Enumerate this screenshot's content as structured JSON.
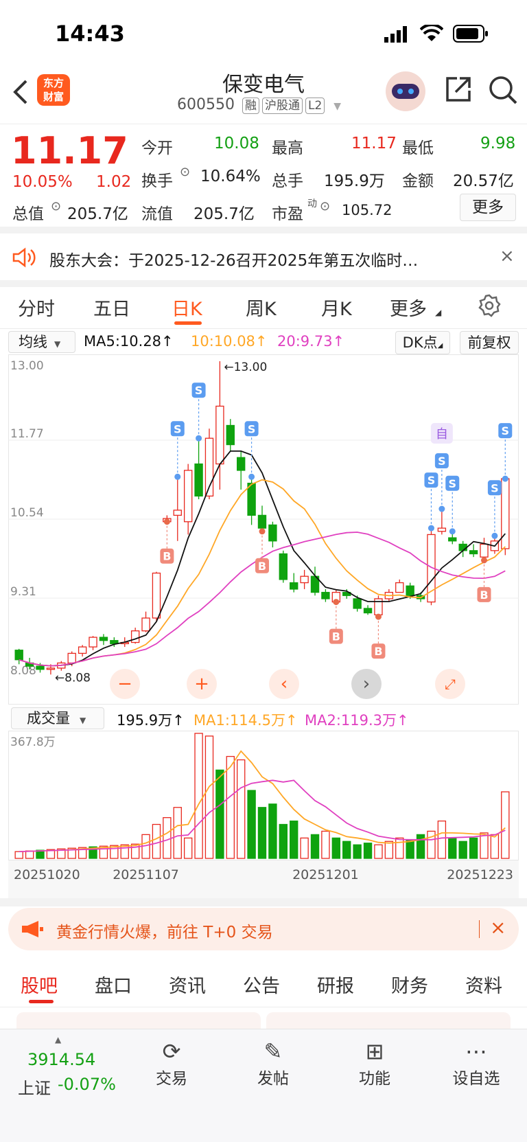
{
  "status_bar": {
    "time": "14:43"
  },
  "header": {
    "title": "保变电气",
    "code": "600550",
    "tags": [
      "融",
      "沪股通",
      "L2"
    ]
  },
  "quote": {
    "price": "11.17",
    "change_pct": "10.05%",
    "change": "1.02",
    "total_value_label": "总值",
    "total_value": "205.7亿",
    "fields": {
      "open_label": "今开",
      "open": "10.08",
      "high_label": "最高",
      "high": "11.17",
      "low_label": "最低",
      "low": "9.98",
      "turnover_label": "换手",
      "turnover": "10.64%",
      "volume_label": "总手",
      "volume": "195.9万",
      "amount_label": "金额",
      "amount": "20.57亿",
      "float_label": "流值",
      "float": "205.7亿",
      "pe_label": "市盈",
      "pe_sup": "动",
      "pe": "105.72"
    },
    "more_label": "更多"
  },
  "notice": {
    "text": "股东大会：于2025-12-26召开2025年第五次临时…"
  },
  "chart_tabs": {
    "items": [
      "分时",
      "五日",
      "日K",
      "周K",
      "月K",
      "更多"
    ],
    "active": "日K"
  },
  "kline": {
    "indicator": "均线",
    "ma5": "MA5:10.28↑",
    "ma10": "10:10.08↑",
    "ma20": "20:9.73↑",
    "dk_label": "DK点",
    "fq_label": "前复权",
    "y_labels": [
      "13.00",
      "11.77",
      "10.54",
      "9.31",
      "8.08"
    ],
    "high_mark": "←13.00",
    "low_mark": "←8.08",
    "signal_zi": "自",
    "s_label": "S",
    "b_label": "B",
    "colors": {
      "up": "#e8281e",
      "down": "#0fa30f",
      "ma5": "#111111",
      "ma10": "#ffa726",
      "ma20": "#e040c0"
    }
  },
  "volume": {
    "indicator": "成交量",
    "value": "195.9万↑",
    "ma1": "MA1:114.5万↑",
    "ma2": "MA2:119.3万↑",
    "max_label": "367.8万",
    "dates": [
      "20251020",
      "20251107",
      "20251201",
      "20251223"
    ]
  },
  "promo": {
    "text": "黄金行情火爆，前往 T+0 交易"
  },
  "sub_tabs": {
    "items": [
      "股吧",
      "盘口",
      "资讯",
      "公告",
      "研报",
      "财务",
      "资料"
    ],
    "active": "股吧"
  },
  "bottom": {
    "index_value": "3914.54",
    "index_name": "上证",
    "index_change": "-0.07%",
    "tabs": [
      {
        "label": "交易",
        "icon": "trade-icon"
      },
      {
        "label": "发帖",
        "icon": "post-icon"
      },
      {
        "label": "功能",
        "icon": "grid-icon"
      },
      {
        "label": "设自选",
        "icon": "more-icon"
      }
    ]
  },
  "chart_data": [
    {
      "type": "candlestick",
      "title": "",
      "ylim": [
        8.08,
        13.0
      ],
      "ma_lines": [
        "MA5",
        "MA10",
        "MA20"
      ],
      "candles": [
        [
          8.5,
          8.35,
          8.52,
          8.28
        ],
        [
          8.3,
          8.25,
          8.38,
          8.2
        ],
        [
          8.25,
          8.2,
          8.3,
          8.15
        ],
        [
          8.2,
          8.22,
          8.28,
          8.12
        ],
        [
          8.22,
          8.3,
          8.33,
          8.18
        ],
        [
          8.3,
          8.45,
          8.48,
          8.25
        ],
        [
          8.45,
          8.55,
          8.58,
          8.4
        ],
        [
          8.55,
          8.7,
          8.72,
          8.5
        ],
        [
          8.7,
          8.65,
          8.75,
          8.58
        ],
        [
          8.65,
          8.6,
          8.7,
          8.55
        ],
        [
          8.6,
          8.62,
          8.7,
          8.55
        ],
        [
          8.62,
          8.8,
          8.85,
          8.6
        ],
        [
          8.8,
          9.0,
          9.1,
          8.78
        ],
        [
          9.0,
          9.7,
          9.72,
          8.95
        ],
        [
          10.5,
          10.55,
          10.6,
          10.5
        ],
        [
          10.6,
          10.68,
          11.2,
          10.2
        ],
        [
          10.5,
          11.3,
          11.4,
          10.3
        ],
        [
          11.4,
          10.9,
          11.8,
          10.85
        ],
        [
          10.9,
          11.8,
          11.95,
          10.85
        ],
        [
          11.4,
          12.3,
          13.0,
          11.0
        ],
        [
          12.0,
          11.7,
          12.1,
          11.6
        ],
        [
          11.5,
          11.3,
          11.6,
          11.0
        ],
        [
          11.1,
          10.6,
          11.2,
          10.45
        ],
        [
          10.6,
          10.4,
          10.75,
          10.35
        ],
        [
          10.45,
          10.2,
          10.5,
          10.1
        ],
        [
          10.0,
          9.6,
          10.05,
          9.55
        ],
        [
          9.55,
          9.45,
          9.7,
          9.4
        ],
        [
          9.55,
          9.65,
          9.75,
          9.45
        ],
        [
          9.65,
          9.4,
          9.8,
          9.35
        ],
        [
          9.4,
          9.3,
          9.45,
          9.25
        ],
        [
          9.25,
          9.4,
          9.45,
          9.25
        ],
        [
          9.4,
          9.35,
          9.45,
          9.3
        ],
        [
          9.3,
          9.15,
          9.35,
          9.1
        ],
        [
          9.15,
          9.08,
          9.2,
          9.05
        ],
        [
          9.05,
          9.3,
          9.35,
          9.02
        ],
        [
          9.3,
          9.4,
          9.45,
          9.25
        ],
        [
          9.4,
          9.55,
          9.6,
          9.4
        ],
        [
          9.5,
          9.35,
          9.55,
          9.3
        ],
        [
          9.35,
          9.3,
          9.4,
          9.25
        ],
        [
          9.25,
          10.3,
          10.4,
          9.2
        ],
        [
          10.35,
          10.4,
          10.7,
          10.3
        ],
        [
          10.25,
          10.2,
          10.35,
          10.15
        ],
        [
          10.15,
          10.05,
          10.2,
          9.95
        ],
        [
          10.05,
          10.0,
          10.15,
          9.95
        ],
        [
          9.95,
          10.15,
          10.25,
          9.9
        ],
        [
          10.05,
          10.2,
          10.28,
          10.0
        ],
        [
          10.08,
          11.17,
          11.17,
          9.98
        ]
      ]
    },
    {
      "type": "bar",
      "title": "",
      "ylim": [
        0,
        367.8
      ],
      "unit": "万",
      "values": [
        20,
        22,
        24,
        26,
        28,
        30,
        32,
        34,
        36,
        38,
        40,
        42,
        70,
        100,
        120,
        150,
        60,
        368,
        360,
        260,
        300,
        290,
        200,
        150,
        160,
        100,
        110,
        60,
        70,
        80,
        60,
        50,
        40,
        45,
        40,
        50,
        60,
        55,
        70,
        80,
        110,
        60,
        50,
        60,
        75,
        70,
        195.9
      ],
      "up": [
        1,
        1,
        0,
        1,
        1,
        1,
        1,
        0,
        1,
        1,
        1,
        1,
        1,
        1,
        1,
        1,
        1,
        1,
        1,
        0,
        1,
        1,
        0,
        0,
        0,
        0,
        0,
        1,
        0,
        1,
        0,
        0,
        0,
        0,
        1,
        1,
        1,
        0,
        0,
        1,
        1,
        0,
        0,
        0,
        1,
        1,
        1
      ]
    }
  ]
}
